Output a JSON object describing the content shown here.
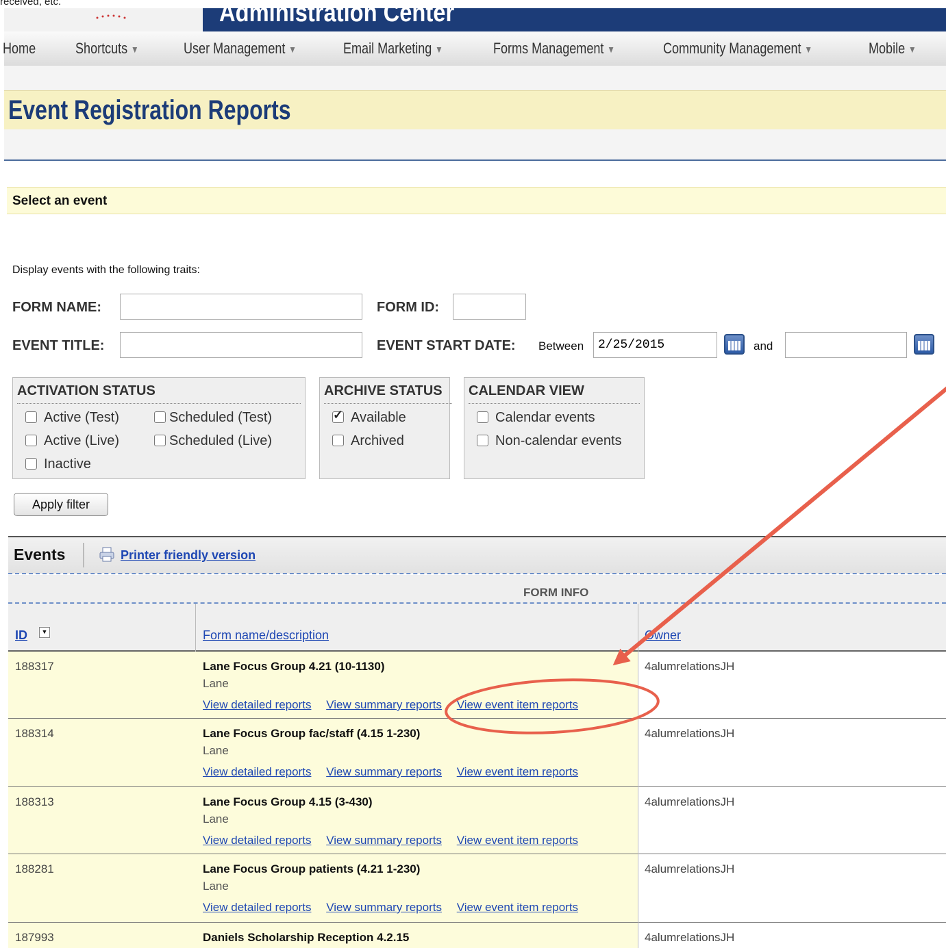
{
  "caption": "received, etc.",
  "banner": {
    "title": "Administration Center"
  },
  "nav": {
    "items": [
      {
        "label": "Home",
        "caret": ""
      },
      {
        "label": "Shortcuts",
        "caret": "▼"
      },
      {
        "label": "User Management",
        "caret": "▼"
      },
      {
        "label": "Email Marketing",
        "caret": "▼"
      },
      {
        "label": "Forms Management",
        "caret": "▼"
      },
      {
        "label": "Community Management",
        "caret": "▼"
      },
      {
        "label": "Mobile",
        "caret": "▼"
      }
    ]
  },
  "page": {
    "title": "Event Registration Reports",
    "section": "Select an event"
  },
  "filter": {
    "intro": "Display events with the following traits:",
    "form_name_label": "FORM NAME:",
    "form_name_value": "",
    "form_id_label": "FORM ID:",
    "form_id_value": "",
    "event_title_label": "EVENT TITLE:",
    "event_title_value": "",
    "start_date_label": "EVENT START DATE:",
    "between": "Between",
    "start_value": "2/25/2015",
    "and": "and",
    "end_value": "",
    "activation": {
      "title": "ACTIVATION STATUS",
      "options": [
        {
          "label": "Active (Test)",
          "checked": false
        },
        {
          "label": "Scheduled (Test)",
          "checked": false
        },
        {
          "label": "Active (Live)",
          "checked": false
        },
        {
          "label": "Scheduled (Live)",
          "checked": false
        },
        {
          "label": "Inactive",
          "checked": false
        }
      ]
    },
    "archive": {
      "title": "ARCHIVE STATUS",
      "options": [
        {
          "label": "Available",
          "checked": true
        },
        {
          "label": "Archived",
          "checked": false
        }
      ]
    },
    "calendar": {
      "title": "CALENDAR VIEW",
      "options": [
        {
          "label": "Calendar events",
          "checked": false
        },
        {
          "label": "Non-calendar events",
          "checked": false
        }
      ]
    },
    "apply_label": "Apply filter"
  },
  "events": {
    "title": "Events",
    "printer_link": "Printer friendly version",
    "group_header": "FORM INFO",
    "columns": {
      "id": "ID",
      "form": "Form name/description",
      "owner": "Owner"
    },
    "link_labels": {
      "detailed": "View detailed reports",
      "summary": "View summary reports",
      "item": "View event item reports"
    },
    "rows": [
      {
        "id": "188317",
        "name": "Lane Focus Group 4.21 (10-1130)",
        "desc": "Lane",
        "owner": "4alumrelationsJH"
      },
      {
        "id": "188314",
        "name": "Lane Focus Group fac/staff (4.15 1-230)",
        "desc": "Lane",
        "owner": "4alumrelationsJH"
      },
      {
        "id": "188313",
        "name": "Lane Focus Group 4.15 (3-430)",
        "desc": "Lane",
        "owner": "4alumrelationsJH"
      },
      {
        "id": "188281",
        "name": "Lane Focus Group patients (4.21 1-230)",
        "desc": "Lane",
        "owner": "4alumrelationsJH"
      },
      {
        "id": "187993",
        "name": "Daniels Scholarship Reception 4.2.15",
        "desc": "",
        "owner": "4alumrelationsJH"
      }
    ]
  },
  "annotation_color": "#e8604c"
}
